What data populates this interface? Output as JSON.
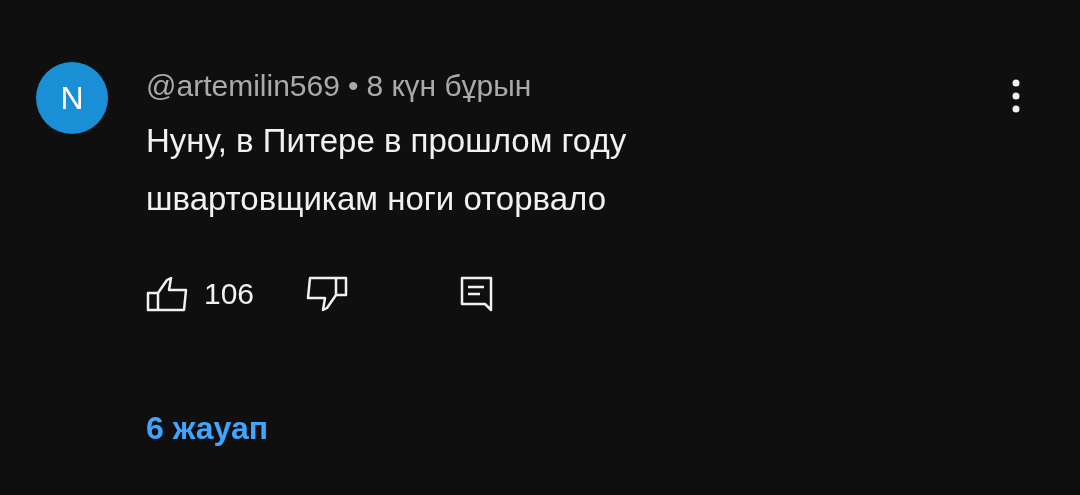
{
  "comment": {
    "avatar_letter": "N",
    "author": "@artemilin569",
    "separator": "•",
    "time": "8 күн бұрын",
    "text": "Нуну, в Питере в прошлом году швартовщикам ноги оторвало",
    "likes": "106",
    "replies_link": "6 жауап"
  }
}
